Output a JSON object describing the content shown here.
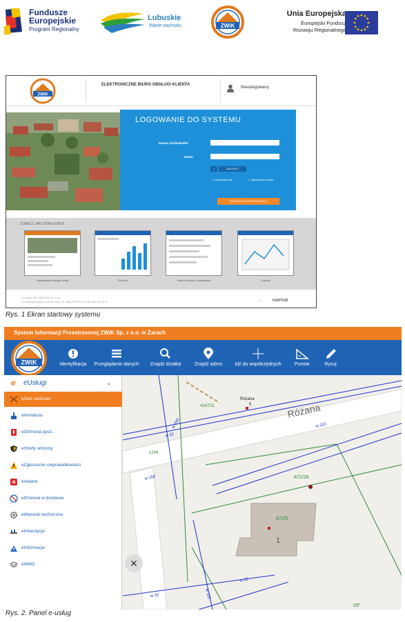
{
  "logos": {
    "fe_line1": "Fundusze",
    "fe_line2": "Europejskie",
    "fe_line3": "Program Regionalny",
    "lubuskie": "Lubuskie",
    "lubuskie_tagline": "Warte zachodu",
    "zwik_badge": "ZWiK",
    "ue_line1": "Unia Europejska",
    "ue_line2": "Europejski Fundusz",
    "ue_line3": "Rozwoju Regionalnego"
  },
  "screen1": {
    "header_title": "ELEKTRONICZNE BIURO OBSŁUGI KLIENTA",
    "user_status": "Niezalogowany",
    "login_title": "LOGOWANIE DO SYSTEMU",
    "username_label": "Numer użytkownika:",
    "password_label": "Hasło:",
    "login_button": "ZALOGUJ",
    "register_link": "> Zarejestruj się",
    "forgot_link": "> Zapomniane hasło",
    "geoportal_button": "PRZEJDŹ DO GEOPORTALU",
    "demo_label": "ZOBACZ JAK DZIAŁA EBOK",
    "cards": [
      {
        "caption": "Rejestracja nowego konta"
      },
      {
        "caption": "Finanse"
      },
      {
        "caption": "Dane osobowe i zgłoszenia"
      },
      {
        "caption": "Zużycie"
      }
    ],
    "footer_line1": "Copyright 2017 ZWiK Żary Sp. z o.o.",
    "footer_line2": "ul. Szklarska Poręba 6, 68-200 Żary, Tel.: (68) 479 45 10/11, Fax: (68) 479 46 12",
    "footer_version": "1.0",
    "footer_brand": "KARTGIS"
  },
  "caption1": "Rys. 1 Ekran startowy systemu",
  "screen2": {
    "title_bar": "System Informacji Przestrzennej ZWiK Sp. z o.o. w Żarach",
    "tools": [
      {
        "label": "Identyfikacja",
        "icon": "info-icon"
      },
      {
        "label": "Przeglądanie danych",
        "icon": "list-icon"
      },
      {
        "label": "Znajdź działkę",
        "icon": "search-icon"
      },
      {
        "label": "Znajdź adres",
        "icon": "pin-icon"
      },
      {
        "label": "Idź do współrzędnych",
        "icon": "crosshair-icon"
      },
      {
        "label": "Pomiar",
        "icon": "ruler-icon"
      },
      {
        "label": "Rysuj",
        "icon": "pencil-icon"
      }
    ],
    "panel_prefix": "e",
    "panel_title": "eUsługi",
    "menu": [
      {
        "label": "eSieć wod-kan",
        "icon": "network-icon"
      },
      {
        "label": "eArmatura",
        "icon": "valve-icon"
      },
      {
        "label": "eOchrona ppoż.",
        "icon": "fire-icon"
      },
      {
        "label": "eStrefy ochrony",
        "icon": "shield-icon"
      },
      {
        "label": "eZgłoszenie nieprawidłowości",
        "icon": "warning-icon"
      },
      {
        "label": "eAwarie",
        "icon": "failure-icon"
      },
      {
        "label": "ePrzerwa w dostawie",
        "icon": "interruption-icon"
      },
      {
        "label": "eWarunki techniczne",
        "icon": "gear-icon"
      },
      {
        "label": "eInwestycje",
        "icon": "investment-icon"
      },
      {
        "label": "eInformacje",
        "icon": "information-icon"
      },
      {
        "label": "eWMS",
        "icon": "layers-icon"
      }
    ],
    "map": {
      "street": "Różana",
      "parcel_a": "872/28",
      "parcel_b": "872/5",
      "building_no": "1",
      "parcel_c": "4247/11",
      "parcel_d": "1248",
      "label_rozana_small": "Różana",
      "address_no": "5",
      "pipe_w32": "w 32",
      "pipe_w110": "w 110",
      "pipe_w160": "w 160",
      "bottom_label": "09°"
    }
  },
  "caption2": "Rys. 2. Panel e-usług"
}
